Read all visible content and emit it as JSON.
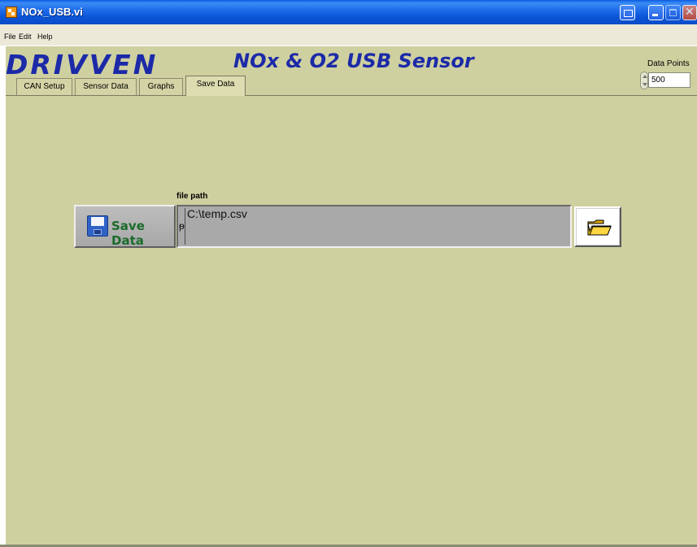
{
  "window": {
    "title": "NOx_USB.vi"
  },
  "menu": {
    "items": [
      "File",
      "Edit",
      "Help"
    ]
  },
  "header": {
    "logo": "DRIVVEN",
    "subtitle": "NOx & O2 USB Sensor"
  },
  "data_points": {
    "label": "Data Points",
    "value": "500"
  },
  "tabs": [
    {
      "label": "CAN Setup",
      "active": false
    },
    {
      "label": "Sensor Data",
      "active": false
    },
    {
      "label": "Graphs",
      "active": false
    },
    {
      "label": "Save Data",
      "active": true
    }
  ],
  "save_panel": {
    "save_button_label": "Save Data",
    "file_path_label": "file path",
    "file_path_value": "C:\\temp.csv",
    "path_glyph": "𝄞"
  },
  "colors": {
    "panel_bg": "#cfd0a0",
    "brand": "#1c2aa8",
    "save_text": "#1a6b2a"
  }
}
